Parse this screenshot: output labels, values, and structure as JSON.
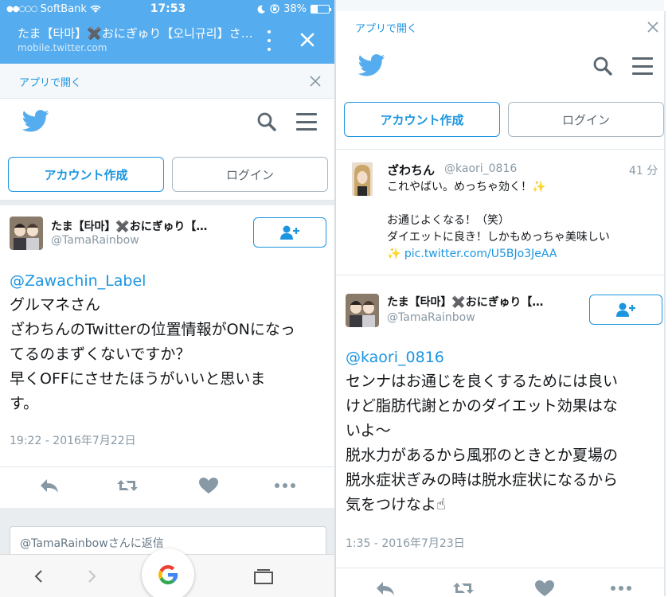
{
  "colors": {
    "twitter_blue": "#55acee",
    "link_blue": "#1b95e0",
    "gray_text": "#8899a6",
    "action_gray": "#8899a6"
  },
  "status_bar": {
    "carrier": "SoftBank",
    "time": "17:53",
    "battery_level": "38%",
    "battery_fraction": 0.38,
    "icons": [
      "signal-dots",
      "wifi-icon",
      "moon-icon",
      "lock-rotation-icon",
      "battery-icon"
    ]
  },
  "browser": {
    "title": "たま【타마】✖️おにぎゅり【오니규리】さ…",
    "url": "mobile.twitter.com",
    "icons": [
      "more-vertical-icon",
      "close-icon"
    ]
  },
  "app_banner": {
    "label": "アプリで開く",
    "icon": "close-icon"
  },
  "header": {
    "icons": [
      "twitter-bird-icon",
      "search-icon",
      "menu-icon"
    ]
  },
  "buttons": {
    "create_account": "アカウント作成",
    "login": "ログイン"
  },
  "left_tweet": {
    "name": "たま【타마】✖️おにぎゅり【…",
    "handle": "@TamaRainbow",
    "mention": "@Zawachin_Label",
    "lines": [
      "グルマネさん",
      "ざわちんのTwitterの位置情報がONになっ",
      "てるのまずくないですか？",
      "早くOFFにさせたほうがいいと思いま",
      "す。"
    ],
    "timestamp": "19:22 - 2016年7月22日",
    "follow_icon": "add-user-icon",
    "actions": [
      "reply-icon",
      "retweet-icon",
      "like-icon",
      "more-icon"
    ]
  },
  "reply_placeholder": "@TamaRainbowさんに返信",
  "bottom_nav": {
    "icons": [
      "back-icon",
      "forward-icon",
      "google-icon",
      "tabs-icon"
    ],
    "google_letter": "G"
  },
  "right_first_tweet": {
    "name": "ざわちん",
    "handle": "@kaori_0816",
    "time_ago": "41 分",
    "lines": [
      "これやばい。めっちゃ効く！✨",
      "",
      "お通じよくなる！（笑）",
      "ダイエットに良き！しかもめっちゃ美味しい"
    ],
    "last_prefix": "✨ ",
    "link": "pic.twitter.com/U5BJo3JeAA"
  },
  "right_second_tweet": {
    "name": "たま【타마】✖️おにぎゅり【…",
    "handle": "@TamaRainbow",
    "mention": "@kaori_0816",
    "lines": [
      "センナはお通じを良くするためには良い",
      "けど脂肪代謝とかのダイエット効果はな",
      "いよ〜",
      "脱水力があるから風邪のときとか夏場の",
      "脱水症状ぎみの時は脱水症状になるから",
      "気をつけなよ☝"
    ],
    "timestamp": "1:35 - 2016年7月23日",
    "follow_icon": "add-user-icon",
    "actions": [
      "reply-icon",
      "retweet-icon",
      "like-icon",
      "more-icon"
    ]
  }
}
